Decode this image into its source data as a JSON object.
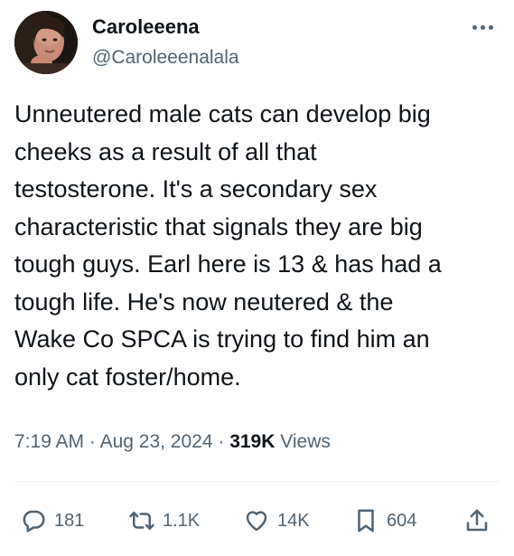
{
  "author": {
    "name": "Caroleeena",
    "handle": "@Caroleeenalala"
  },
  "tweet": {
    "lines": [
      "Unneutered male cats can develop big",
      "cheeks as a result of all that",
      "testosterone. It's a secondary sex",
      "characteristic that signals they are big",
      "tough guys.  Earl here is 13 & has had a",
      "tough life. He's now neutered & the",
      "Wake Co SPCA is trying to find him an",
      "only cat foster/home."
    ],
    "time": "7:19 AM",
    "separator": " · ",
    "date": "Aug 23, 2024",
    "views_count": "319K",
    "views_label": " Views"
  },
  "actions": {
    "replies": "181",
    "reposts": "1.1K",
    "likes": "14K",
    "bookmarks": "604"
  },
  "icons": {
    "more": "more-horizontal-icon",
    "reply": "reply-icon",
    "repost": "repost-icon",
    "like": "heart-icon",
    "bookmark": "bookmark-icon",
    "share": "share-icon"
  },
  "colors": {
    "text": "#0f1419",
    "secondary": "#536471",
    "divider": "#eff3f4"
  }
}
